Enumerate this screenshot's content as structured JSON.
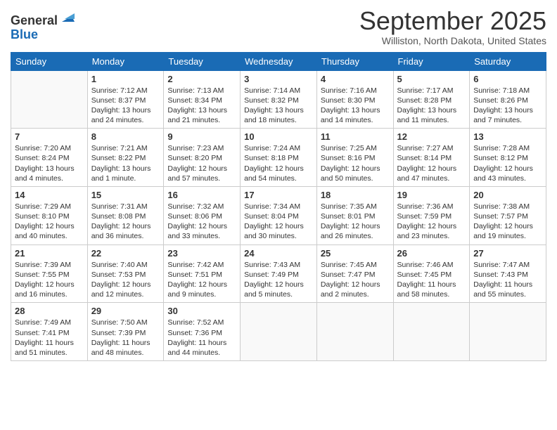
{
  "header": {
    "logo": {
      "general": "General",
      "blue": "Blue"
    },
    "title": "September 2025",
    "location": "Williston, North Dakota, United States"
  },
  "columns": [
    "Sunday",
    "Monday",
    "Tuesday",
    "Wednesday",
    "Thursday",
    "Friday",
    "Saturday"
  ],
  "weeks": [
    [
      {
        "day": "",
        "sunrise": "",
        "sunset": "",
        "daylight": ""
      },
      {
        "day": "1",
        "sunrise": "Sunrise: 7:12 AM",
        "sunset": "Sunset: 8:37 PM",
        "daylight": "Daylight: 13 hours and 24 minutes."
      },
      {
        "day": "2",
        "sunrise": "Sunrise: 7:13 AM",
        "sunset": "Sunset: 8:34 PM",
        "daylight": "Daylight: 13 hours and 21 minutes."
      },
      {
        "day": "3",
        "sunrise": "Sunrise: 7:14 AM",
        "sunset": "Sunset: 8:32 PM",
        "daylight": "Daylight: 13 hours and 18 minutes."
      },
      {
        "day": "4",
        "sunrise": "Sunrise: 7:16 AM",
        "sunset": "Sunset: 8:30 PM",
        "daylight": "Daylight: 13 hours and 14 minutes."
      },
      {
        "day": "5",
        "sunrise": "Sunrise: 7:17 AM",
        "sunset": "Sunset: 8:28 PM",
        "daylight": "Daylight: 13 hours and 11 minutes."
      },
      {
        "day": "6",
        "sunrise": "Sunrise: 7:18 AM",
        "sunset": "Sunset: 8:26 PM",
        "daylight": "Daylight: 13 hours and 7 minutes."
      }
    ],
    [
      {
        "day": "7",
        "sunrise": "Sunrise: 7:20 AM",
        "sunset": "Sunset: 8:24 PM",
        "daylight": "Daylight: 13 hours and 4 minutes."
      },
      {
        "day": "8",
        "sunrise": "Sunrise: 7:21 AM",
        "sunset": "Sunset: 8:22 PM",
        "daylight": "Daylight: 13 hours and 1 minute."
      },
      {
        "day": "9",
        "sunrise": "Sunrise: 7:23 AM",
        "sunset": "Sunset: 8:20 PM",
        "daylight": "Daylight: 12 hours and 57 minutes."
      },
      {
        "day": "10",
        "sunrise": "Sunrise: 7:24 AM",
        "sunset": "Sunset: 8:18 PM",
        "daylight": "Daylight: 12 hours and 54 minutes."
      },
      {
        "day": "11",
        "sunrise": "Sunrise: 7:25 AM",
        "sunset": "Sunset: 8:16 PM",
        "daylight": "Daylight: 12 hours and 50 minutes."
      },
      {
        "day": "12",
        "sunrise": "Sunrise: 7:27 AM",
        "sunset": "Sunset: 8:14 PM",
        "daylight": "Daylight: 12 hours and 47 minutes."
      },
      {
        "day": "13",
        "sunrise": "Sunrise: 7:28 AM",
        "sunset": "Sunset: 8:12 PM",
        "daylight": "Daylight: 12 hours and 43 minutes."
      }
    ],
    [
      {
        "day": "14",
        "sunrise": "Sunrise: 7:29 AM",
        "sunset": "Sunset: 8:10 PM",
        "daylight": "Daylight: 12 hours and 40 minutes."
      },
      {
        "day": "15",
        "sunrise": "Sunrise: 7:31 AM",
        "sunset": "Sunset: 8:08 PM",
        "daylight": "Daylight: 12 hours and 36 minutes."
      },
      {
        "day": "16",
        "sunrise": "Sunrise: 7:32 AM",
        "sunset": "Sunset: 8:06 PM",
        "daylight": "Daylight: 12 hours and 33 minutes."
      },
      {
        "day": "17",
        "sunrise": "Sunrise: 7:34 AM",
        "sunset": "Sunset: 8:04 PM",
        "daylight": "Daylight: 12 hours and 30 minutes."
      },
      {
        "day": "18",
        "sunrise": "Sunrise: 7:35 AM",
        "sunset": "Sunset: 8:01 PM",
        "daylight": "Daylight: 12 hours and 26 minutes."
      },
      {
        "day": "19",
        "sunrise": "Sunrise: 7:36 AM",
        "sunset": "Sunset: 7:59 PM",
        "daylight": "Daylight: 12 hours and 23 minutes."
      },
      {
        "day": "20",
        "sunrise": "Sunrise: 7:38 AM",
        "sunset": "Sunset: 7:57 PM",
        "daylight": "Daylight: 12 hours and 19 minutes."
      }
    ],
    [
      {
        "day": "21",
        "sunrise": "Sunrise: 7:39 AM",
        "sunset": "Sunset: 7:55 PM",
        "daylight": "Daylight: 12 hours and 16 minutes."
      },
      {
        "day": "22",
        "sunrise": "Sunrise: 7:40 AM",
        "sunset": "Sunset: 7:53 PM",
        "daylight": "Daylight: 12 hours and 12 minutes."
      },
      {
        "day": "23",
        "sunrise": "Sunrise: 7:42 AM",
        "sunset": "Sunset: 7:51 PM",
        "daylight": "Daylight: 12 hours and 9 minutes."
      },
      {
        "day": "24",
        "sunrise": "Sunrise: 7:43 AM",
        "sunset": "Sunset: 7:49 PM",
        "daylight": "Daylight: 12 hours and 5 minutes."
      },
      {
        "day": "25",
        "sunrise": "Sunrise: 7:45 AM",
        "sunset": "Sunset: 7:47 PM",
        "daylight": "Daylight: 12 hours and 2 minutes."
      },
      {
        "day": "26",
        "sunrise": "Sunrise: 7:46 AM",
        "sunset": "Sunset: 7:45 PM",
        "daylight": "Daylight: 11 hours and 58 minutes."
      },
      {
        "day": "27",
        "sunrise": "Sunrise: 7:47 AM",
        "sunset": "Sunset: 7:43 PM",
        "daylight": "Daylight: 11 hours and 55 minutes."
      }
    ],
    [
      {
        "day": "28",
        "sunrise": "Sunrise: 7:49 AM",
        "sunset": "Sunset: 7:41 PM",
        "daylight": "Daylight: 11 hours and 51 minutes."
      },
      {
        "day": "29",
        "sunrise": "Sunrise: 7:50 AM",
        "sunset": "Sunset: 7:39 PM",
        "daylight": "Daylight: 11 hours and 48 minutes."
      },
      {
        "day": "30",
        "sunrise": "Sunrise: 7:52 AM",
        "sunset": "Sunset: 7:36 PM",
        "daylight": "Daylight: 11 hours and 44 minutes."
      },
      {
        "day": "",
        "sunrise": "",
        "sunset": "",
        "daylight": ""
      },
      {
        "day": "",
        "sunrise": "",
        "sunset": "",
        "daylight": ""
      },
      {
        "day": "",
        "sunrise": "",
        "sunset": "",
        "daylight": ""
      },
      {
        "day": "",
        "sunrise": "",
        "sunset": "",
        "daylight": ""
      }
    ]
  ]
}
